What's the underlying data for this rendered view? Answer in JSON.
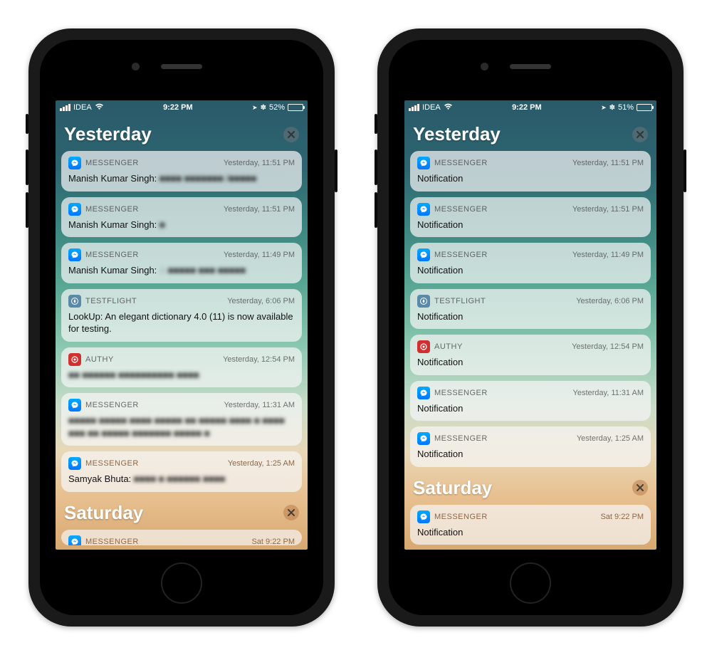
{
  "statusbar": {
    "carrier": "IDEA",
    "time": "9:22 PM",
    "location_glyph": "➤",
    "bt_glyph": "✽",
    "battery_left_pct": "52%",
    "battery_right_pct": "51%",
    "battery_left_fill": "52%",
    "battery_right_fill": "51%"
  },
  "sections": {
    "yesterday": "Yesterday",
    "saturday": "Saturday"
  },
  "apps": {
    "messenger": "MESSENGER",
    "testflight": "TESTFLIGHT",
    "authy": "AUTHY"
  },
  "left": {
    "cards": [
      {
        "app": "messenger",
        "time": "Yesterday, 11:51 PM",
        "body_prefix": "Manish Kumar Singh: ",
        "body_blurred": "■■■■ ■■■■■■■ /■■■■■"
      },
      {
        "app": "messenger",
        "time": "Yesterday, 11:51 PM",
        "body_prefix": "Manish Kumar Singh: ",
        "body_blurred": "■"
      },
      {
        "app": "messenger",
        "time": "Yesterday, 11:49 PM",
        "body_prefix": "Manish Kumar Singh: ",
        "body_blurred": "∴ ■■■■■ ■■■ ■■■■■"
      },
      {
        "app": "testflight",
        "time": "Yesterday, 6:06 PM",
        "body_prefix": "LookUp: An elegant dictionary 4.0 (11) is now available for testing.",
        "body_blurred": ""
      },
      {
        "app": "authy",
        "time": "Yesterday, 12:54 PM",
        "body_prefix": "",
        "body_blurred": "■■ ■■■■■■ ■■■■■■■■■■ ■■■■"
      },
      {
        "app": "messenger",
        "time": "Yesterday, 11:31 AM",
        "body_prefix": "",
        "body_blurred": "■■■■■ ■■■■■ ■■■■ ■■■■■ ■■ ■■■■■ ■■■■ ■ ■■■■ ■■■ ■■ ■■■■■ ■■■■■■■ ■■■■■ ■"
      },
      {
        "app": "messenger",
        "time": "Yesterday, 1:25 AM",
        "body_prefix": "Samyak Bhuta: ",
        "body_blurred": "■■■■ ■ ■■■■■■ ■■■■"
      }
    ],
    "truncated": {
      "app": "messenger",
      "time": "Sat 9:22 PM"
    }
  },
  "right": {
    "generic_body": "Notification",
    "cards": [
      {
        "app": "messenger",
        "time": "Yesterday, 11:51 PM"
      },
      {
        "app": "messenger",
        "time": "Yesterday, 11:51 PM"
      },
      {
        "app": "messenger",
        "time": "Yesterday, 11:49 PM"
      },
      {
        "app": "testflight",
        "time": "Yesterday, 6:06 PM"
      },
      {
        "app": "authy",
        "time": "Yesterday, 12:54 PM"
      },
      {
        "app": "messenger",
        "time": "Yesterday, 11:31 AM"
      },
      {
        "app": "messenger",
        "time": "Yesterday, 1:25 AM"
      }
    ],
    "saturday_card": {
      "app": "messenger",
      "time": "Sat 9:22 PM"
    }
  }
}
